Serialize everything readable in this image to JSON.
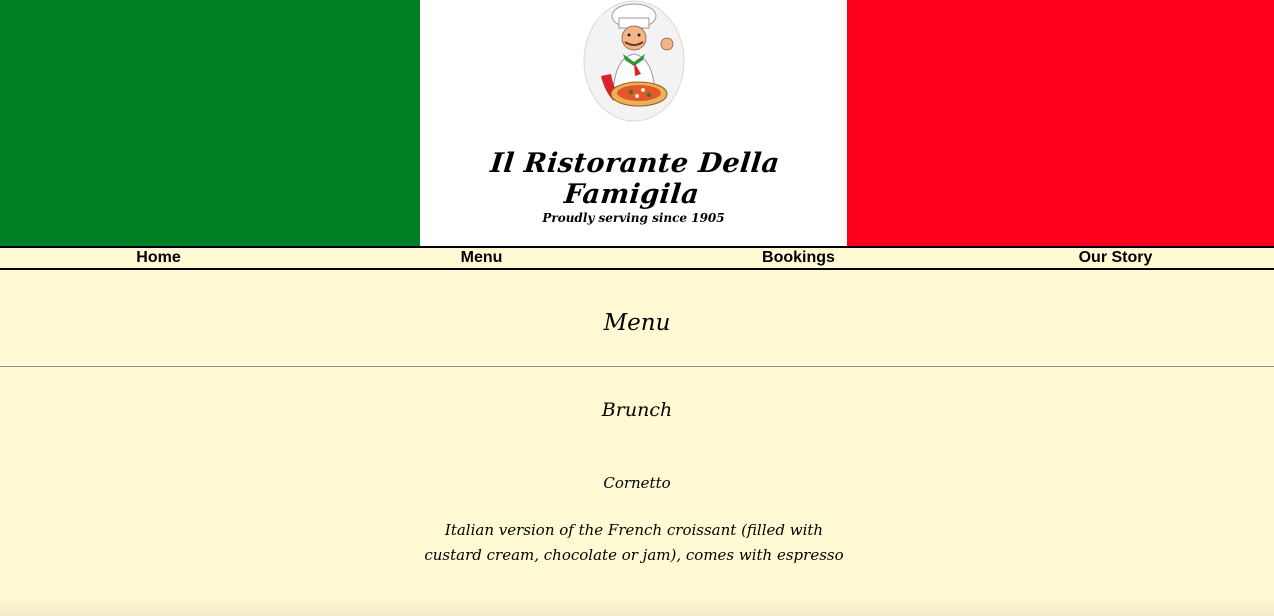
{
  "colors": {
    "flag_green": "#008025",
    "flag_white": "#ffffff",
    "flag_red": "#ff001c",
    "background": "#fffad3"
  },
  "header": {
    "logo_icon": "chef-with-pizza-logo",
    "restaurant_name": "Il Ristorante Della Famigila",
    "tagline": "Proudly serving since 1905"
  },
  "nav": {
    "items": [
      {
        "label": "Home"
      },
      {
        "label": "Menu"
      },
      {
        "label": "Bookings"
      },
      {
        "label": "Our Story"
      }
    ]
  },
  "main": {
    "title": "Menu",
    "sections": [
      {
        "title": "Brunch",
        "items": [
          {
            "name": "Cornetto",
            "description": "Italian version of the French croissant (filled with custard cream, chocolate or jam), comes with espresso"
          }
        ]
      }
    ]
  }
}
